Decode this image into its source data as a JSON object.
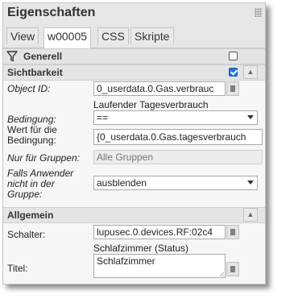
{
  "window": {
    "title": "Eigenschaften"
  },
  "tabs": [
    {
      "label": "View"
    },
    {
      "label": "w00005"
    },
    {
      "label": "CSS"
    },
    {
      "label": "Skripte"
    }
  ],
  "sections": {
    "generell": {
      "label": "Generell"
    },
    "sichtbarkeit": {
      "label": "Sichtbarkeit",
      "object_id": {
        "label": "Object ID:",
        "value": "0_userdata.0.Gas.verbrauc",
        "hint": "Laufender Tagesverbrauch"
      },
      "bedingung": {
        "label": "Bedingung:",
        "value": "=="
      },
      "wert": {
        "label_line1": "Wert für die",
        "label_line2": "Bedingung:",
        "value": "{0_userdata.0.Gas.tagesverbrauch"
      },
      "nur_fuer_gruppen": {
        "label": "Nur für Gruppen:",
        "value": "Alle Gruppen"
      },
      "falls_anwender": {
        "label_line1": "Falls Anwender",
        "label_line2": "nicht in der",
        "label_line3": "Gruppe:",
        "value": "ausblenden"
      }
    },
    "allgemein": {
      "label": "Allgemein",
      "schalter": {
        "label": "Schalter:",
        "value": "lupusec.0.devices.RF:02c4",
        "hint": "Schlafzimmer (Status)"
      },
      "titel": {
        "label": "Titel:",
        "value": "Schlafzimmer"
      }
    }
  },
  "colors": {
    "checkbox_checked": "#1a73e8",
    "header_bg": "#e4e4e4",
    "panel_bg": "#f6f6f6"
  }
}
